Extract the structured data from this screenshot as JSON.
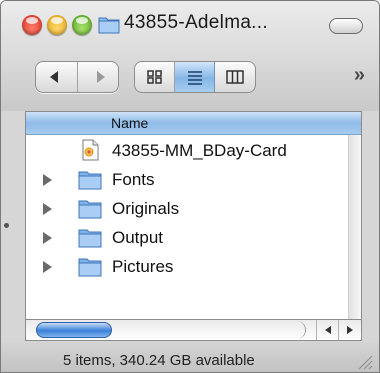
{
  "window": {
    "title": "43855-Adelma..."
  },
  "toolbar": {
    "back_icon": "back-arrow-icon",
    "forward_icon": "forward-arrow-icon",
    "views": [
      "icon-view",
      "list-view",
      "column-view"
    ],
    "selected_view": "list-view",
    "overflow_label": "»"
  },
  "list": {
    "column_header": "Name",
    "items": [
      {
        "label": "43855-MM_BDay-Card",
        "icon": "document-icon",
        "expandable": false
      },
      {
        "label": "Fonts",
        "icon": "folder-icon",
        "expandable": true
      },
      {
        "label": "Originals",
        "icon": "folder-icon",
        "expandable": true
      },
      {
        "label": "Output",
        "icon": "folder-icon",
        "expandable": true
      },
      {
        "label": "Pictures",
        "icon": "folder-icon",
        "expandable": true
      }
    ]
  },
  "status": {
    "text": "5 items, 340.24 GB available"
  },
  "colors": {
    "close": "#d42a1c",
    "minimize": "#e0a215",
    "zoom": "#4e9d1c",
    "selection_blue": "#86b6e6",
    "folder_blue": "#7fb2e8"
  }
}
